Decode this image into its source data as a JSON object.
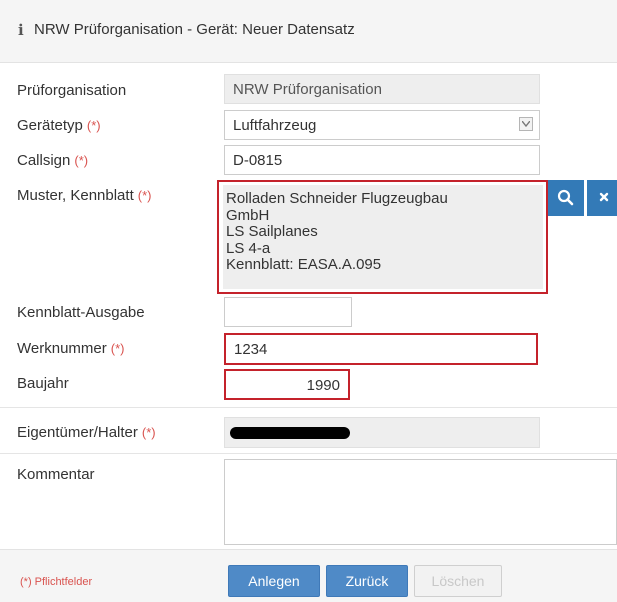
{
  "header": {
    "info_icon": "ℹ",
    "title": "NRW Prüforganisation - Gerät: Neuer Datensatz"
  },
  "required_marker": "(*)",
  "form": {
    "prueforganisation": {
      "label": "Prüforganisation",
      "value": "NRW Prüforganisation"
    },
    "geraetetyp": {
      "label": "Gerätetyp",
      "value": "Luftfahrzeug"
    },
    "callsign": {
      "label": "Callsign",
      "value": "D-0815"
    },
    "muster": {
      "label": "Muster, Kennblatt",
      "lines": [
        "Rolladen Schneider Flugzeugbau",
        "GmbH",
        "LS Sailplanes",
        "LS 4-a",
        "Kennblatt: EASA.A.095"
      ]
    },
    "kennblatt_ausgabe": {
      "label": "Kennblatt-Ausgabe",
      "value": ""
    },
    "werknummer": {
      "label": "Werknummer",
      "value": "1234"
    },
    "baujahr": {
      "label": "Baujahr",
      "value": "1990"
    },
    "eigentuemer": {
      "label": "Eigentümer/Halter",
      "value": ""
    },
    "kommentar": {
      "label": "Kommentar",
      "value": ""
    }
  },
  "footer": {
    "note": "(*) Pflichtfelder",
    "buttons": {
      "anlegen": "Anlegen",
      "zurueck": "Zurück",
      "loeschen": "Löschen"
    }
  },
  "colors": {
    "accent": "#337ab7",
    "error_border": "#c4222b",
    "required": "#d9534f"
  },
  "icons": {
    "search": "search-icon",
    "clear": "close-icon",
    "dropdown": "chevron-down-icon"
  }
}
